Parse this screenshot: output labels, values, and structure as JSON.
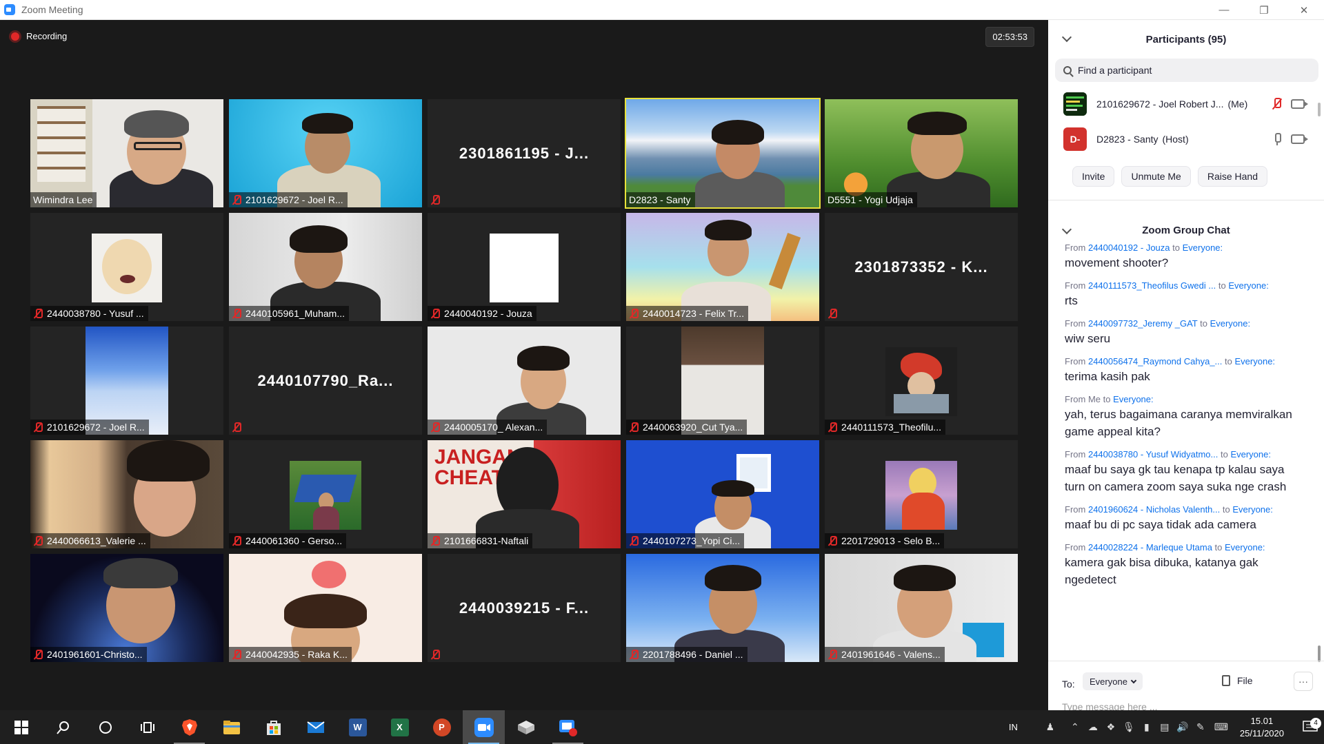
{
  "window": {
    "title": "Zoom Meeting"
  },
  "meeting": {
    "recording_label": "Recording",
    "timer": "02:53:53"
  },
  "tiles": [
    {
      "name": "Wimindra Lee",
      "muted": false,
      "video": true
    },
    {
      "name": "2101629672 - Joel R...",
      "muted": true,
      "video": true
    },
    {
      "name": "",
      "muted": true,
      "video": false,
      "display_name": "2301861195 - J..."
    },
    {
      "name": "D2823 - Santy",
      "muted": false,
      "video": true,
      "speaking": true
    },
    {
      "name": "D5551 - Yogi Udjaja",
      "muted": false,
      "video": true
    },
    {
      "name": "2440038780 - Yusuf ...",
      "muted": true,
      "video": true
    },
    {
      "name": "2440105961_Muham...",
      "muted": true,
      "video": true
    },
    {
      "name": "2440040192 - Jouza",
      "muted": true,
      "video": true
    },
    {
      "name": "2440014723 - Felix Tr...",
      "muted": true,
      "video": true
    },
    {
      "name": "",
      "muted": true,
      "video": false,
      "display_name": "2301873352 - K..."
    },
    {
      "name": "2101629672 - Joel R...",
      "muted": true,
      "video": true
    },
    {
      "name": "",
      "muted": true,
      "video": false,
      "display_name": "2440107790_Ra..."
    },
    {
      "name": "2440005170_ Alexan...",
      "muted": true,
      "video": true
    },
    {
      "name": "2440063920_Cut Tya...",
      "muted": true,
      "video": true
    },
    {
      "name": "2440111573_Theofilu...",
      "muted": true,
      "video": true
    },
    {
      "name": "2440066613_Valerie ...",
      "muted": true,
      "video": true
    },
    {
      "name": "2440061360 - Gerso...",
      "muted": true,
      "video": true
    },
    {
      "name": "2101666831-Naftali",
      "muted": true,
      "video": true
    },
    {
      "name": "2440107273_Yopi Ci...",
      "muted": true,
      "video": true
    },
    {
      "name": "2201729013 - Selo B...",
      "muted": true,
      "video": true
    },
    {
      "name": "2401961601-Christo...",
      "muted": true,
      "video": true
    },
    {
      "name": "2440042935 - Raka K...",
      "muted": true,
      "video": true
    },
    {
      "name": "",
      "muted": true,
      "video": false,
      "display_name": "2440039215 - F..."
    },
    {
      "name": "2201788496 - Daniel ...",
      "muted": true,
      "video": true
    },
    {
      "name": "2401961646 - Valens...",
      "muted": true,
      "video": true
    }
  ],
  "participants": {
    "header": "Participants (95)",
    "search_placeholder": "Find a participant",
    "list": [
      {
        "name": "2101629672 - Joel Robert J...",
        "tag": "(Me)",
        "avatar": "",
        "avatar_color": "#1a3d1a"
      },
      {
        "name": "D2823 - Santy",
        "tag": "(Host)",
        "avatar": "D-",
        "avatar_color": "#d2322d"
      }
    ],
    "buttons": [
      "Invite",
      "Unmute Me",
      "Raise Hand"
    ]
  },
  "chat": {
    "header": "Zoom Group Chat",
    "messages": [
      {
        "from_prefix": "From",
        "sender": "2440040192 - Jouza",
        "to_prefix": "to",
        "recipient": "Everyone:",
        "text": "movement shooter?"
      },
      {
        "from_prefix": "From",
        "sender": "2440111573_Theofilus Gwedi ...",
        "to_prefix": "to",
        "recipient": "Everyone:",
        "text": "rts"
      },
      {
        "from_prefix": "From",
        "sender": "2440097732_Jeremy _GAT",
        "to_prefix": "to",
        "recipient": "Everyone:",
        "text": "wiw seru"
      },
      {
        "from_prefix": "From",
        "sender": "2440056474_Raymond Cahya_...",
        "to_prefix": "to",
        "recipient": "Everyone:",
        "text": "terima kasih pak"
      },
      {
        "from_prefix": "From Me",
        "sender": "",
        "to_prefix": "to",
        "recipient": "Everyone:",
        "text": "yah, terus bagaimana caranya memviralkan game appeal kita?"
      },
      {
        "from_prefix": "From",
        "sender": "2440038780 - Yusuf Widyatmo...",
        "to_prefix": "to",
        "recipient": "Everyone:",
        "text": "maaf bu saya gk tau kenapa tp kalau saya turn on camera zoom saya suka nge crash"
      },
      {
        "from_prefix": "From",
        "sender": "2401960624 - Nicholas Valenth...",
        "to_prefix": "to",
        "recipient": "Everyone:",
        "text": "maaf bu di pc saya tidak ada camera"
      },
      {
        "from_prefix": "From",
        "sender": "2440028224 - Marleque Utama",
        "to_prefix": "to",
        "recipient": "Everyone:",
        "text": "kamera gak bisa dibuka, katanya gak ngedetect"
      }
    ],
    "to_label": "To:",
    "to_value": "Everyone",
    "file_label": "File",
    "more_label": "···",
    "input_placeholder": "Type message here ..."
  },
  "taskbar": {
    "apps": [
      {
        "name": "start",
        "icon": "windows-icon"
      },
      {
        "name": "search",
        "icon": "search-icon"
      },
      {
        "name": "cortana",
        "icon": "cortana-icon"
      },
      {
        "name": "task-view",
        "icon": "task-view-icon"
      },
      {
        "name": "brave",
        "icon": "brave-icon",
        "color": "#fb542b",
        "running": true
      },
      {
        "name": "file-explorer",
        "icon": "folder-icon",
        "color": "#f3c244"
      },
      {
        "name": "store",
        "icon": "store-icon",
        "color": "#e5e5e5"
      },
      {
        "name": "mail",
        "icon": "mail-icon",
        "color": "#1b7ad4"
      },
      {
        "name": "word",
        "icon": "word-icon",
        "color": "#2b579a",
        "letter": "W"
      },
      {
        "name": "excel",
        "icon": "excel-icon",
        "color": "#217346",
        "letter": "X"
      },
      {
        "name": "powerpoint",
        "icon": "powerpoint-icon",
        "color": "#d24726",
        "letter": "P"
      },
      {
        "name": "zoom",
        "icon": "zoom-icon",
        "color": "#2d8cff",
        "active": true
      },
      {
        "name": "virtualbox",
        "icon": "virtualbox-icon",
        "color": "#cfcfcf"
      },
      {
        "name": "zoom-share",
        "icon": "zoom-share-icon",
        "color": "#2d8cff",
        "running": true
      }
    ],
    "lang": "IN",
    "time": "15.01",
    "date": "25/11/2020",
    "notifications": "4"
  }
}
